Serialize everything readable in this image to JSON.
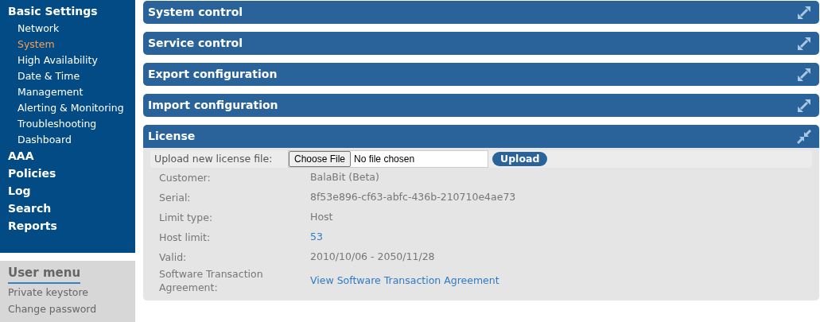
{
  "sidebar": {
    "sections": [
      {
        "label": "Basic Settings",
        "selected": false,
        "children": [
          {
            "label": "Network",
            "selected": false
          },
          {
            "label": "System",
            "selected": true
          },
          {
            "label": "High Availability",
            "selected": false
          },
          {
            "label": "Date & Time",
            "selected": false
          },
          {
            "label": "Management",
            "selected": false
          },
          {
            "label": "Alerting & Monitoring",
            "selected": false
          },
          {
            "label": "Troubleshooting",
            "selected": false
          },
          {
            "label": "Dashboard",
            "selected": false
          }
        ]
      },
      {
        "label": "AAA",
        "selected": false
      },
      {
        "label": "Policies",
        "selected": false
      },
      {
        "label": "Log",
        "selected": false
      },
      {
        "label": "Search",
        "selected": false
      },
      {
        "label": "Reports",
        "selected": false
      }
    ]
  },
  "user_menu": {
    "title": "User menu",
    "items": [
      "Private keystore",
      "Change password"
    ]
  },
  "panels": [
    {
      "title": "System control",
      "expanded": false
    },
    {
      "title": "Service control",
      "expanded": false
    },
    {
      "title": "Export configuration",
      "expanded": false
    },
    {
      "title": "Import configuration",
      "expanded": false
    },
    {
      "title": "License",
      "expanded": true
    }
  ],
  "license": {
    "upload_label": "Upload new license file:",
    "choose_button": "Choose File",
    "file_status": "No file chosen",
    "upload_button": "Upload",
    "fields": [
      {
        "label": "Customer:",
        "value": "BalaBit (Beta)",
        "kind": "text"
      },
      {
        "label": "Serial:",
        "value": "8f53e896-cf63-abfc-436b-210710e4ae73",
        "kind": "text"
      },
      {
        "label": "Limit type:",
        "value": "Host",
        "kind": "text"
      },
      {
        "label": "Host limit:",
        "value": "53",
        "kind": "link"
      },
      {
        "label": "Valid:",
        "value": "2010/10/06 - 2050/11/28",
        "kind": "text"
      },
      {
        "label": "Software Transaction Agreement:",
        "value": "View Software Transaction Agreement",
        "kind": "link"
      }
    ]
  }
}
